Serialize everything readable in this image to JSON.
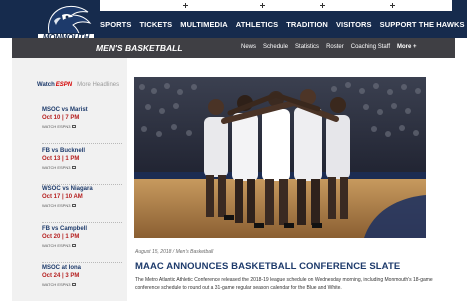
{
  "brand": {
    "logo_text": "MONMOUTH",
    "navy": "#162b4d",
    "accent_red": "#b51f1f",
    "espn_red": "#d40000"
  },
  "main_nav": [
    {
      "label": "SPORTS"
    },
    {
      "label": "TICKETS"
    },
    {
      "label": "MULTIMEDIA"
    },
    {
      "label": "ATHLETICS"
    },
    {
      "label": "TRADITION"
    },
    {
      "label": "VISITORS"
    },
    {
      "label": "SUPPORT THE HAWKS"
    }
  ],
  "sub_header": {
    "title": "MEN'S BASKETBALL",
    "nav": [
      {
        "label": "News"
      },
      {
        "label": "Schedule"
      },
      {
        "label": "Statistics"
      },
      {
        "label": "Roster"
      },
      {
        "label": "Coaching Staff"
      },
      {
        "label": "More +"
      }
    ]
  },
  "sidebar": {
    "watch_label": "Watch",
    "espn_label": "ESPN",
    "more_label": "More Headlines",
    "games": [
      {
        "teams": "MSOC vs Marist",
        "date": "Oct 10 | 7 PM",
        "watch": "WATCH ESPN3"
      },
      {
        "teams": "FB vs Bucknell",
        "date": "Oct 13 | 1 PM",
        "watch": "WATCH ESPN3"
      },
      {
        "teams": "WSOC vs Niagara",
        "date": "Oct 17 | 10 AM",
        "watch": "WATCH ESPN3"
      },
      {
        "teams": "FB vs Campbell",
        "date": "Oct 20 | 1 PM",
        "watch": "WATCH ESPN3"
      },
      {
        "teams": "MSOC at Iona",
        "date": "Oct 24 | 3 PM",
        "watch": "WATCH ESPN3"
      }
    ]
  },
  "article": {
    "meta": "August 15, 2018 / Men's Basketball",
    "headline": "MAAC ANNOUNCES BASKETBALL CONFERENCE SLATE",
    "summary": "The Metro Atlantic Athletic Conference released the 2018-19 league schedule on Wednesday morning, including Monmouth's 18-game conference schedule to round out a 31-game regular season calendar for the Blue and White."
  },
  "icons": {
    "search": "search-icon",
    "tv": "tv-icon",
    "photo": "team-huddle-photo"
  }
}
